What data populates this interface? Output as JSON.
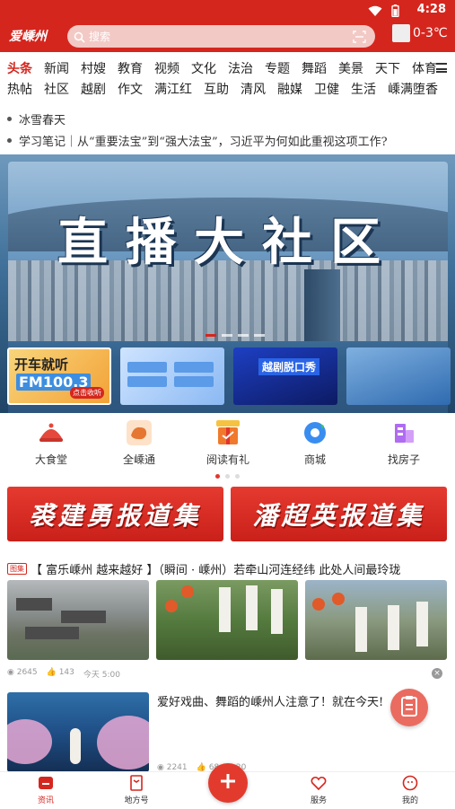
{
  "status_bar": {
    "time": "4:28"
  },
  "header": {
    "logo": "爱嵊州",
    "search_placeholder": "搜索",
    "weather": "0-3℃",
    "accent": "#d5261e"
  },
  "channels": {
    "row1": [
      "头条",
      "新闻",
      "村嫂",
      "教育",
      "视频",
      "文化",
      "法治",
      "专题",
      "舞蹈",
      "美景",
      "天下",
      "体育"
    ],
    "row2": [
      "热帖",
      "社区",
      "越剧",
      "作文",
      "满江红",
      "互助",
      "清风",
      "融媒",
      "卫健",
      "生活",
      "嵊满堕香"
    ],
    "active": "头条"
  },
  "headlines": [
    "冰雪春天",
    "学习笔记｜从“重要法宝”到“强大法宝”，习近平为何如此重视这项工作?"
  ],
  "banner": {
    "title": "直播大社区",
    "thumbs": [
      {
        "line1": "开车就听",
        "line2": "FM100.3",
        "line3": "点击收听"
      },
      {
        "line1": ""
      },
      {
        "line1": "越剧脱口秀"
      },
      {
        "line1": ""
      }
    ]
  },
  "shortcuts": [
    {
      "label": "大食堂",
      "icon": "food-cover-icon"
    },
    {
      "label": "全嵊通",
      "icon": "map-icon"
    },
    {
      "label": "阅读有礼",
      "icon": "gift-icon"
    },
    {
      "label": "商城",
      "icon": "shop-icon"
    },
    {
      "label": "找房子",
      "icon": "house-icon"
    }
  ],
  "promos": [
    "裘建勇报道集",
    "潘超英报道集"
  ],
  "news_item1": {
    "tag": "图集",
    "title": "【 富乐嵊州  越来越好 】（瞬间 · 嵊州）若牵山河连经纬   此处人间最玲珑",
    "views": "2645",
    "likes": "143",
    "time": "今天 5:00"
  },
  "news_item2": {
    "title": "爱好戏曲、舞蹈的嵊州人注意了！就在今天!",
    "views": "2241",
    "likes": "68",
    "time": "9:20"
  },
  "tabbar": {
    "items": [
      "资讯",
      "地方号",
      "服务",
      "我的"
    ],
    "active": "资讯"
  }
}
